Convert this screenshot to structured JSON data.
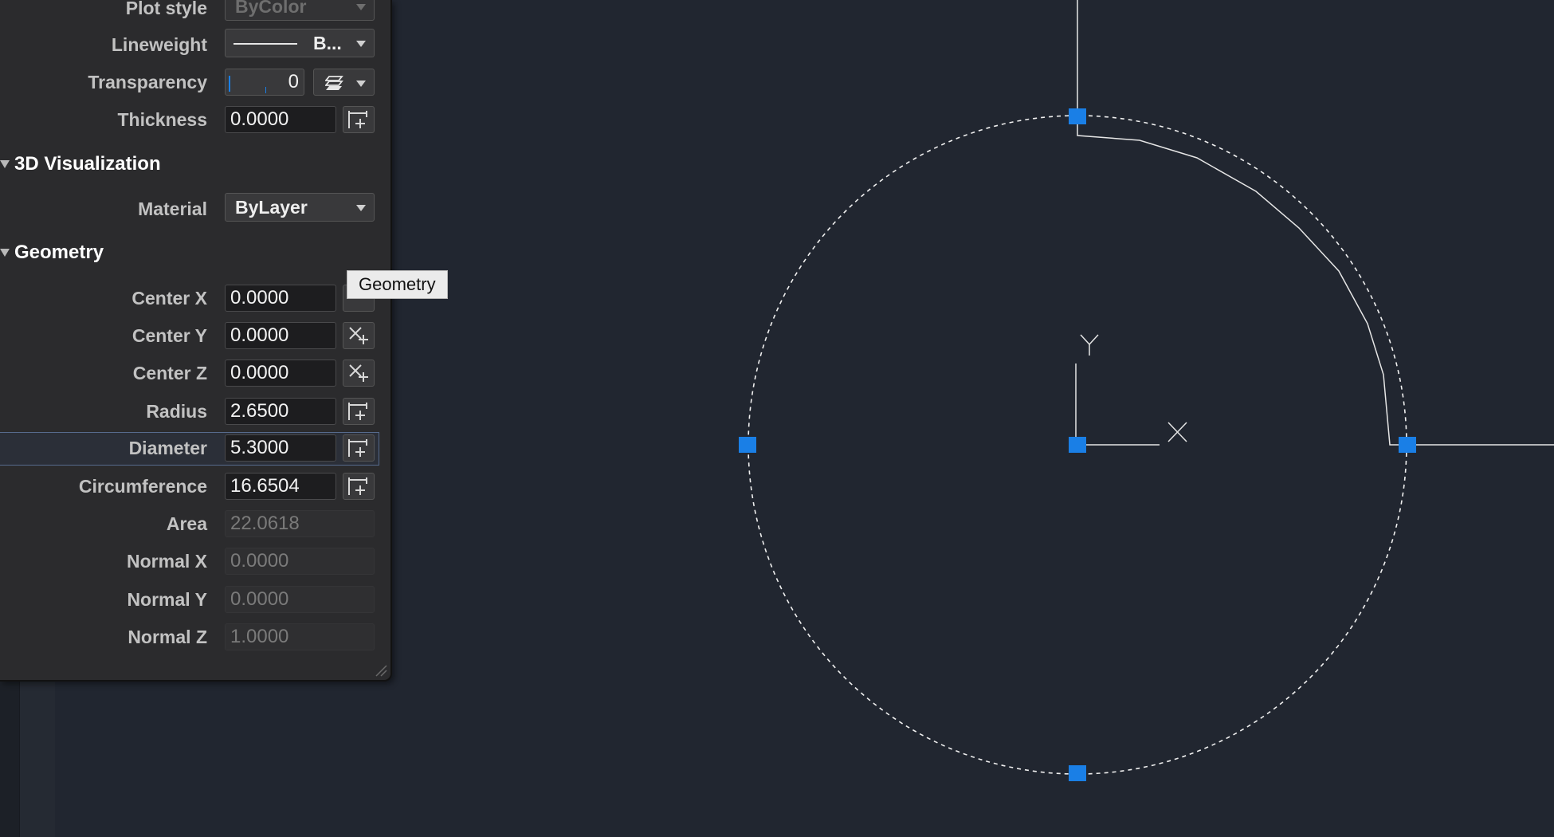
{
  "panel": {
    "plot_style": {
      "label": "Plot style",
      "value": "ByColor"
    },
    "lineweight": {
      "label": "Lineweight",
      "value": "B..."
    },
    "transparency": {
      "label": "Transparency",
      "value": "0",
      "icon": "layers-icon"
    },
    "thickness": {
      "label": "Thickness",
      "value": "0.0000"
    },
    "sections": {
      "visualization": "3D Visualization",
      "geometry": "Geometry"
    },
    "material": {
      "label": "Material",
      "value": "ByLayer"
    },
    "geometry": {
      "center_x": {
        "label": "Center X",
        "value": "0.0000"
      },
      "center_y": {
        "label": "Center Y",
        "value": "0.0000"
      },
      "center_z": {
        "label": "Center Z",
        "value": "0.0000"
      },
      "radius": {
        "label": "Radius",
        "value": "2.6500"
      },
      "diameter": {
        "label": "Diameter",
        "value": "5.3000"
      },
      "circumference": {
        "label": "Circumference",
        "value": "16.6504"
      },
      "area": {
        "label": "Area",
        "value": "22.0618"
      },
      "normal_x": {
        "label": "Normal X",
        "value": "0.0000"
      },
      "normal_y": {
        "label": "Normal Y",
        "value": "0.0000"
      },
      "normal_z": {
        "label": "Normal Z",
        "value": "1.0000"
      }
    },
    "selected_row": "diameter"
  },
  "tooltip": {
    "text": "Geometry"
  },
  "canvas": {
    "background": "#212630",
    "grip_color": "#1a7fe6",
    "ucs_labels": {
      "x": "X",
      "y": "Y"
    }
  }
}
